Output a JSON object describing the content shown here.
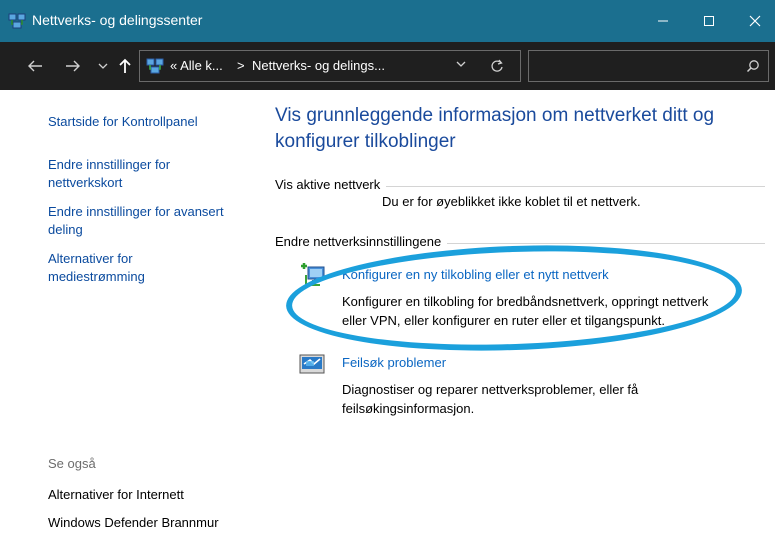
{
  "window": {
    "title": "Nettverks- og delingssenter"
  },
  "address_bar": {
    "crumb_root": "« Alle k...",
    "crumb_separator": ">",
    "crumb_current": "Nettverks- og delings...",
    "search_placeholder": ""
  },
  "sidebar": {
    "home_link": "Startside for Kontrollpanel",
    "links": [
      {
        "line1": "Endre innstillinger for",
        "line2": "nettverkskort"
      },
      {
        "line1": "Endre innstillinger for avansert",
        "line2": "deling"
      },
      {
        "line1": "Alternativer for",
        "line2": "mediestrømming"
      }
    ],
    "see_also_label": "Se også",
    "see_also_links": [
      "Alternativer for Internett",
      "Windows Defender Brannmur"
    ]
  },
  "main": {
    "heading_line1": "Vis grunnleggende informasjon om nettverket ditt og",
    "heading_line2": "konfigurer tilkoblinger",
    "active_networks_label": "Vis aktive nettverk",
    "not_connected_text": "Du er for øyeblikket ikke koblet til et nettverk.",
    "change_settings_label": "Endre nettverksinnstillingene",
    "tasks": [
      {
        "title": "Konfigurer en ny tilkobling eller et nytt nettverk",
        "desc_line1": "Konfigurer en tilkobling for bredbåndsnettverk, oppringt nettverk",
        "desc_line2": "eller VPN, eller konfigurer en ruter eller et tilgangspunkt.",
        "icon": "new-connection-icon"
      },
      {
        "title": "Feilsøk problemer",
        "desc_line1": "Diagnostiser og reparer nettverksproblemer, eller få",
        "desc_line2": "feilsøkingsinformasjon.",
        "icon": "troubleshoot-icon"
      }
    ]
  },
  "colors": {
    "titlebar": "#1b6f8f",
    "navbar": "#1f1f1f",
    "link": "#0a4a9e",
    "heading": "#1a4a9c",
    "highlight": "#1ba0dc"
  }
}
